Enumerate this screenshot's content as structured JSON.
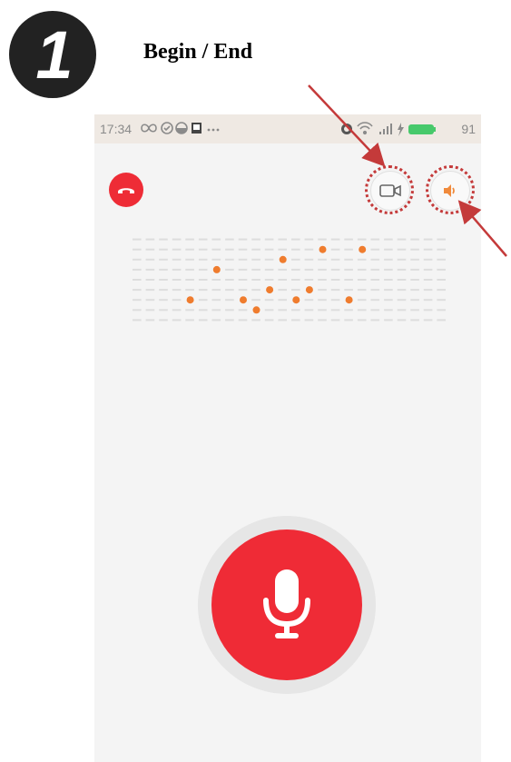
{
  "header": {
    "step_number": "1",
    "title": "Begin / End"
  },
  "status_bar": {
    "time": "17:34",
    "left_icons": [
      "infinity-icon",
      "check-circle-icon",
      "half-circle-icon",
      "square-icon",
      "more-dots-icon"
    ],
    "right_icons": [
      "alarm-icon",
      "wifi-icon",
      "signal-icon",
      "charging-icon",
      "battery-icon"
    ],
    "battery_level": "91"
  },
  "call_screen": {
    "hangup_icon": "phone-hangup-icon",
    "video_icon": "video-camera-icon",
    "speaker_icon": "speaker-icon",
    "mic_icon": "microphone-icon"
  },
  "colors": {
    "accent_red": "#ee2c36",
    "speaker_orange": "#f08a3c",
    "waveform_dot": "#ef7c2e",
    "annotation_red": "#c43a3a",
    "phone_bg": "#f4f4f4",
    "status_bar_bg": "#efe9e3"
  }
}
